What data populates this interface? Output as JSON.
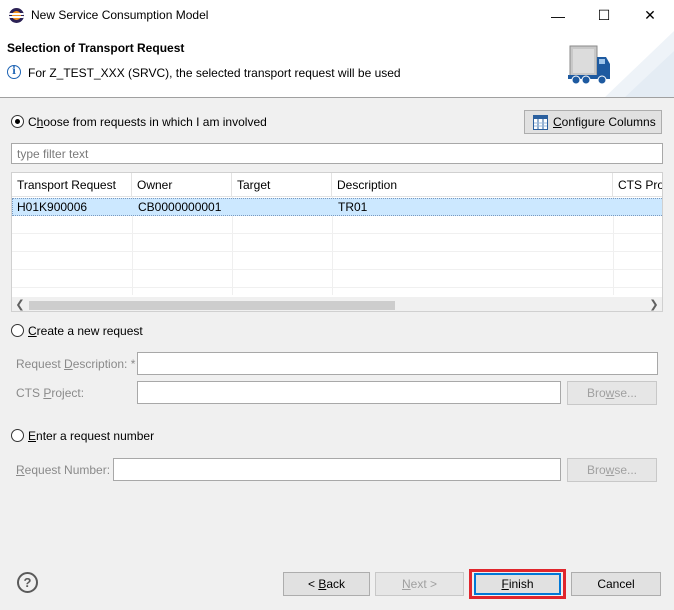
{
  "window": {
    "title": "New Service Consumption Model",
    "controls": {
      "minimize": "—",
      "maximize": "☐",
      "close": "✕"
    }
  },
  "banner": {
    "title": "Selection of Transport Request",
    "message": "For Z_TEST_XXX (SRVC), the selected transport request will be used",
    "info_icon": "i"
  },
  "involved": {
    "label_pre": "C",
    "label_u": "h",
    "label_post": "oose from requests in which I am involved",
    "selected": true
  },
  "configure_columns": {
    "label_pre": "",
    "label_u": "C",
    "label_post": "onfigure Columns"
  },
  "filter": {
    "placeholder": "type filter text"
  },
  "table": {
    "headers": [
      "Transport Request",
      "Owner",
      "Target",
      "Description",
      "CTS Project"
    ],
    "rows": [
      {
        "request": "H01K900006",
        "owner": "CB0000000001",
        "target": "",
        "description": "TR01",
        "cts": ""
      }
    ]
  },
  "create_new": {
    "label_pre": "",
    "label_u": "C",
    "label_post": "reate a new request",
    "description_label": {
      "pre": "Request ",
      "u": "D",
      "post": "escription: *"
    },
    "cts_label": {
      "pre": "CTS ",
      "u": "P",
      "post": "roject:"
    },
    "browse": {
      "pre": "Bro",
      "u": "w",
      "post": "se..."
    }
  },
  "enter_number": {
    "label_pre": "",
    "label_u": "E",
    "label_post": "nter a request number",
    "number_label": {
      "pre": "",
      "u": "R",
      "post": "equest Number:"
    },
    "browse": {
      "pre": "Bro",
      "u": "w",
      "post": "se..."
    }
  },
  "footer": {
    "help": "?",
    "back": {
      "pre": "< ",
      "u": "B",
      "post": "ack"
    },
    "next": {
      "pre": "",
      "u": "N",
      "post": "ext >"
    },
    "finish": {
      "pre": "",
      "u": "F",
      "post": "inish"
    },
    "cancel": "Cancel"
  },
  "colors": {
    "selection": "#cce8ff",
    "highlight": "#e0262d",
    "accent": "#1e64b4"
  }
}
